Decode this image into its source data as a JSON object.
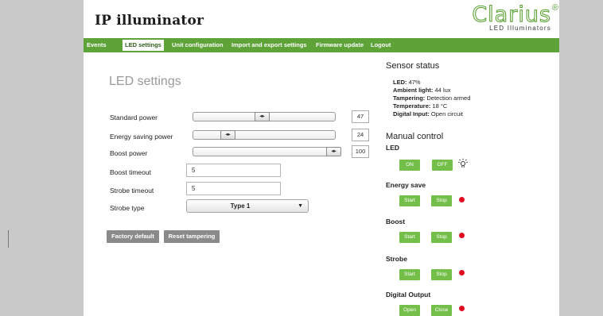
{
  "header": {
    "title": "IP illuminator",
    "logo": {
      "name": "Clarius",
      "reg": "®",
      "tagline": "LED Illuminators"
    }
  },
  "nav": {
    "items": [
      {
        "label": "Events"
      },
      {
        "label": "LED settings",
        "active": true
      },
      {
        "label": "Unit configuration"
      },
      {
        "label": "Import and export settings"
      },
      {
        "label": "Firmware update"
      },
      {
        "label": "Logout"
      }
    ]
  },
  "led_settings": {
    "title": "LED settings",
    "standard_power": {
      "label": "Standard power",
      "value": "47"
    },
    "energy_saving_power": {
      "label": "Energy saving power",
      "value": "24"
    },
    "boost_power": {
      "label": "Boost power",
      "value": "100"
    },
    "boost_timeout": {
      "label": "Boost timeout",
      "value": "5"
    },
    "strobe_timeout": {
      "label": "Strobe timeout",
      "value": "5"
    },
    "strobe_type": {
      "label": "Strobe type",
      "value": "Type 1"
    },
    "factory_default_label": "Factory default",
    "reset_tampering_label": "Reset tampering",
    "slider_thumb_glyph": "◂▸"
  },
  "sensor_status": {
    "title": "Sensor status",
    "lines": [
      {
        "key": "LED:",
        "value": "47%"
      },
      {
        "key": "Ambient light:",
        "value": "44 lux"
      },
      {
        "key": "Tampering:",
        "value": "Detection armed"
      },
      {
        "key": "Temperature:",
        "value": "18 °C"
      },
      {
        "key": "Digital Input:",
        "value": "Open circuit"
      }
    ]
  },
  "manual_control": {
    "title": "Manual control",
    "led": {
      "title": "LED",
      "on_label": "ON",
      "off_label": "OFF",
      "icon": "light-bulb-icon"
    },
    "energy_save": {
      "title": "Energy save",
      "start_label": "Start",
      "stop_label": "Stop"
    },
    "boost": {
      "title": "Boost",
      "start_label": "Start",
      "stop_label": "Stop"
    },
    "strobe": {
      "title": "Strobe",
      "start_label": "Start",
      "stop_label": "Stop"
    },
    "digital_output": {
      "title": "Digital Output",
      "open_label": "Open",
      "close_label": "Close"
    }
  },
  "colors": {
    "nav_green": "#5ea337",
    "button_green": "#74bf49",
    "indicator_red": "#e00a1e",
    "gray_button": "#8a8a8a",
    "page_background": "#c9c9c9"
  }
}
